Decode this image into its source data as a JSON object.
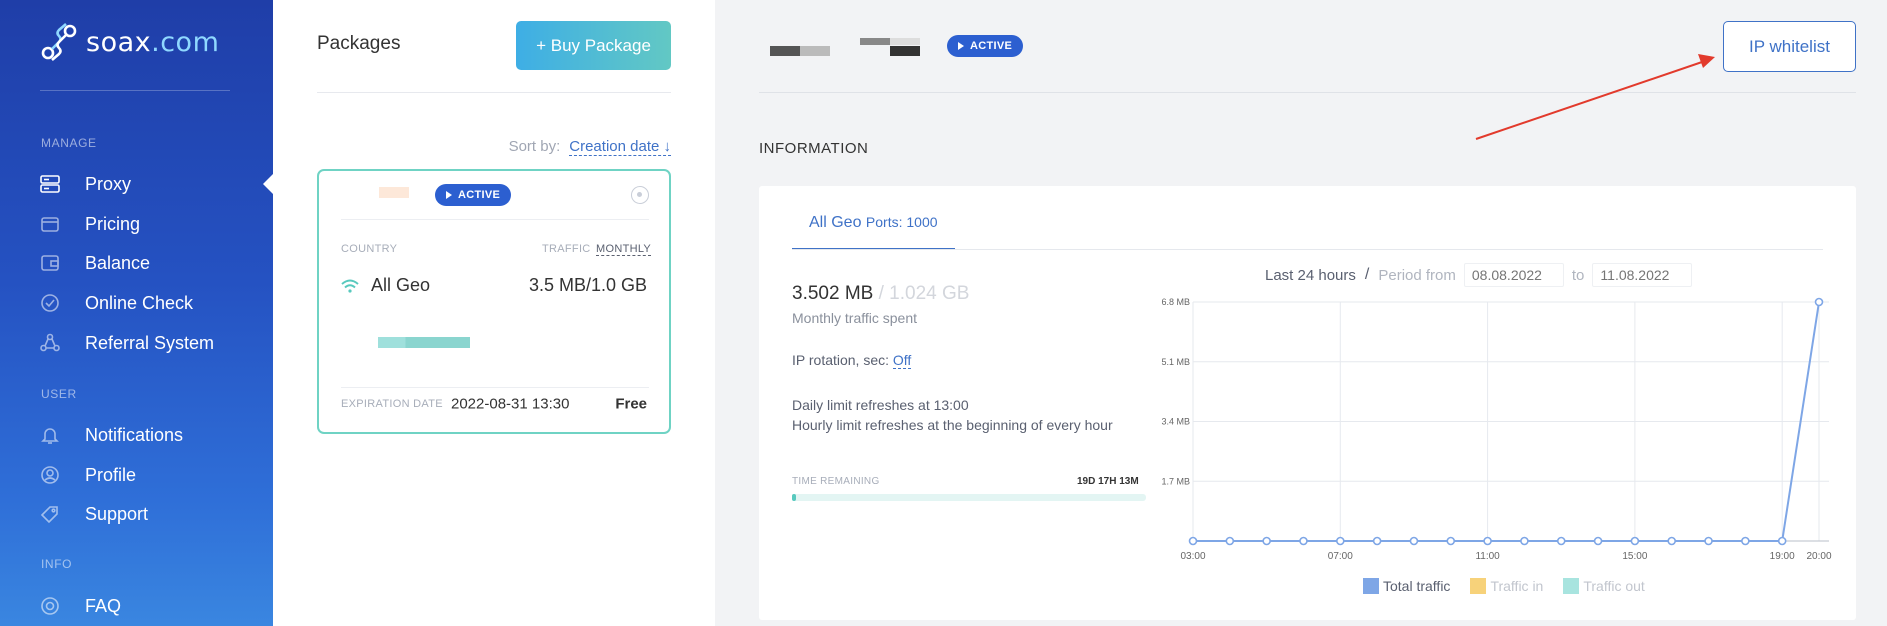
{
  "brand": {
    "name": "soax",
    "suffix": ".com"
  },
  "sidebar": {
    "sections": [
      "MANAGE",
      "USER",
      "INFO"
    ],
    "items": [
      {
        "label": "Proxy",
        "icon": "proxy-icon"
      },
      {
        "label": "Pricing",
        "icon": "pricing-icon"
      },
      {
        "label": "Balance",
        "icon": "wallet-icon"
      },
      {
        "label": "Online Check",
        "icon": "check-icon"
      },
      {
        "label": "Referral System",
        "icon": "referral-icon"
      },
      {
        "label": "Notifications",
        "icon": "bell-icon"
      },
      {
        "label": "Profile",
        "icon": "user-icon"
      },
      {
        "label": "Support",
        "icon": "tag-icon"
      },
      {
        "label": "FAQ",
        "icon": "help-icon"
      }
    ]
  },
  "packages": {
    "title": "Packages",
    "buy_button": "+ Buy Package",
    "sort_label": "Sort by:",
    "sort_value": "Creation date ↓",
    "card": {
      "status": "ACTIVE",
      "country_label": "COUNTRY",
      "traffic_label": "TRAFFIC",
      "traffic_mode": "MONTHLY",
      "country": "All Geo",
      "traffic": "3.5 MB/1.0 GB",
      "expiration_label": "EXPIRATION DATE",
      "expiration_value": "2022-08-31 13:30",
      "plan": "Free"
    }
  },
  "header": {
    "status": "ACTIVE",
    "ip_whitelist_button": "IP whitelist"
  },
  "info": {
    "heading": "INFORMATION",
    "tab_label": "All Geo",
    "tab_ports": "Ports: 1000",
    "spent": "3.502 MB",
    "spent_limit": "/ 1.024 GB",
    "spent_label": "Monthly traffic spent",
    "rotation_label": "IP rotation, sec:",
    "rotation_value": "Off",
    "daily_refresh": "Daily limit refreshes at 13:00",
    "hourly_refresh": "Hourly limit refreshes at the beginning of every hour",
    "time_remaining_label": "TIME REMAINING",
    "time_remaining_value": "19D 17H 13M",
    "time_remaining_fraction": 0.01,
    "period_last": "Last 24 hours",
    "period_slash": "/",
    "period_from_label": "Period from",
    "period_from": "08.08.2022",
    "period_to_label": "to",
    "period_to": "11.08.2022"
  },
  "chart_data": {
    "type": "line",
    "x": [
      "03:00",
      "04:00",
      "05:00",
      "06:00",
      "07:00",
      "08:00",
      "09:00",
      "10:00",
      "11:00",
      "12:00",
      "13:00",
      "14:00",
      "15:00",
      "16:00",
      "17:00",
      "18:00",
      "19:00",
      "20:00"
    ],
    "x_tick_labels": [
      "03:00",
      "07:00",
      "11:00",
      "15:00",
      "19:00",
      "20:00"
    ],
    "y_tick_labels": [
      "6.8 MB",
      "5.1 MB",
      "3.4 MB",
      "1.7 MB"
    ],
    "ylim": [
      0,
      6.8
    ],
    "series": [
      {
        "name": "Total traffic",
        "color": "#7ea6e6",
        "values": [
          0,
          0,
          0,
          0,
          0,
          0,
          0,
          0,
          0,
          0,
          0,
          0,
          0,
          0,
          0,
          0,
          0,
          6.8
        ]
      },
      {
        "name": "Traffic in",
        "color": "#f7d27a",
        "values": []
      },
      {
        "name": "Traffic out",
        "color": "#a8e4df",
        "values": []
      }
    ],
    "grid": true,
    "legend": "bottom"
  }
}
